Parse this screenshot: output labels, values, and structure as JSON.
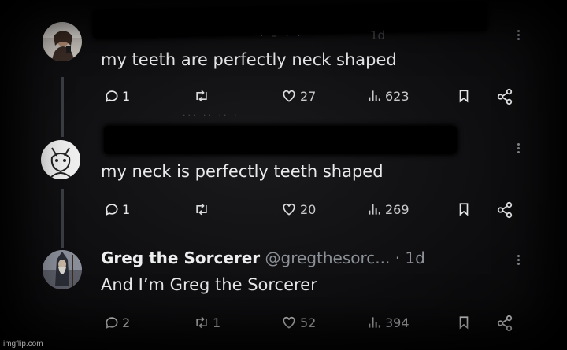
{
  "tweets": [
    {
      "text": "my teeth are perfectly neck shaped",
      "replies": "1",
      "retweets": "",
      "likes": "27",
      "views": "623"
    },
    {
      "text": "my neck is perfectly teeth shaped",
      "replies": "1",
      "retweets": "",
      "likes": "20",
      "views": "269"
    },
    {
      "name": "Greg the Sorcerer",
      "handle": "@gregthesorc...",
      "time": "· 1d",
      "text": "And I’m Greg the Sorcerer",
      "replies": "2",
      "retweets": "1",
      "likes": "52",
      "views": "394"
    }
  ],
  "partial_time_1": "1d",
  "watermark": "imgflip.com",
  "icons": [
    "reply-icon",
    "retweet-icon",
    "heart-icon",
    "views-icon",
    "bookmark-icon",
    "share-icon",
    "more-icon"
  ],
  "colors": {
    "background": "#0e0e10",
    "text": "#e7e9ea",
    "muted": "#8b9196",
    "thread": "#3a3d41"
  }
}
